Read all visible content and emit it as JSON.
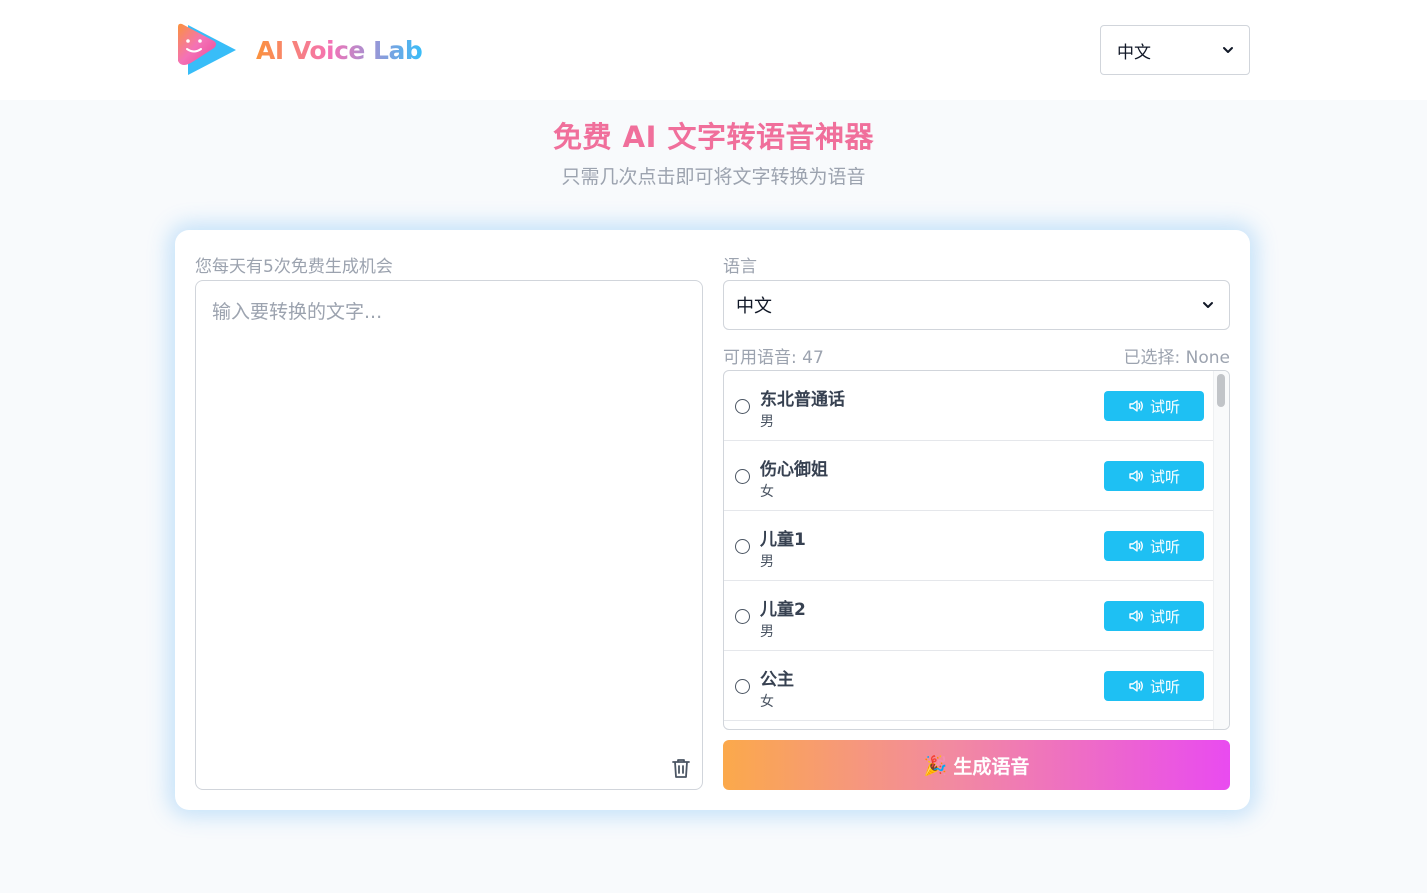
{
  "header": {
    "logo_text": "AI Voice Lab",
    "language": "中文"
  },
  "hero": {
    "title": "免费 AI 文字转语音神器",
    "subtitle": "只需几次点击即可将文字转换为语音"
  },
  "editor": {
    "quota_label": "您每天有5次免费生成机会",
    "placeholder": "输入要转换的文字...",
    "value": ""
  },
  "voice_panel": {
    "language_label": "语言",
    "language_value": "中文",
    "available_text": "可用语音: 47",
    "selected_text": "已选择: None",
    "play_label": "试听",
    "voices": [
      {
        "name": "东北普通话",
        "gender": "男"
      },
      {
        "name": "伤心御姐",
        "gender": "女"
      },
      {
        "name": "儿童1",
        "gender": "男"
      },
      {
        "name": "儿童2",
        "gender": "男"
      },
      {
        "name": "公主",
        "gender": "女"
      }
    ]
  },
  "generate": {
    "emoji": "🎉",
    "label": "生成语音"
  },
  "colors": {
    "accent_blue": "#1ec0f3",
    "title_pink": "#f06f9b",
    "gradient_start": "#fba94b",
    "gradient_end": "#e94bf0"
  }
}
